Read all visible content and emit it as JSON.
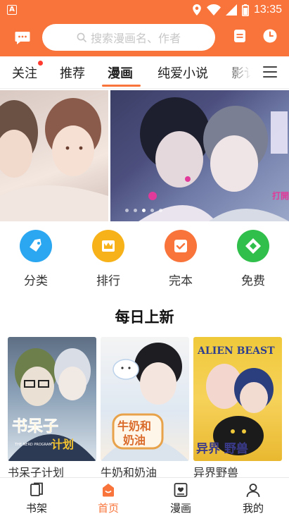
{
  "status_bar": {
    "time": "13:35",
    "icons": [
      "app-notification-icon",
      "location-icon",
      "wifi-icon",
      "signal-icon",
      "battery-icon"
    ]
  },
  "header": {
    "search_placeholder": "搜索漫画名、作者",
    "icons": [
      "chat-icon",
      "history-icon",
      "clock-icon"
    ]
  },
  "tabs": {
    "items": [
      {
        "label": "关注",
        "badge": true
      },
      {
        "label": "推荐"
      },
      {
        "label": "漫画",
        "active": true
      },
      {
        "label": "纯爱小说"
      },
      {
        "label": "影讠"
      }
    ],
    "menu_icon": "menu-icon"
  },
  "banner": {
    "slide_count": 5,
    "active_index": 2,
    "overlay_text": "打開"
  },
  "categories": [
    {
      "label": "分类",
      "icon": "tag-icon",
      "color": "#2aa7f0"
    },
    {
      "label": "排行",
      "icon": "crown-icon",
      "color": "#f7b21a"
    },
    {
      "label": "完本",
      "icon": "check-box-icon",
      "color": "#f8743a"
    },
    {
      "label": "免费",
      "icon": "diamond-icon",
      "color": "#2fbf4a"
    }
  ],
  "section": {
    "title": "每日上新"
  },
  "books": [
    {
      "title": "书呆子计划",
      "cover_text": "书呆子",
      "cover_subtext": "计划",
      "cover_caption": "THE NERD PROGRAM"
    },
    {
      "title": "牛奶和奶油",
      "cover_text": "牛奶和",
      "cover_subtext": "奶油"
    },
    {
      "title": "异界野兽",
      "cover_text": "ALIEN BEAST",
      "cover_subtext": "异界 野兽"
    }
  ],
  "bottom_nav": [
    {
      "label": "书架",
      "icon": "bookshelf-icon"
    },
    {
      "label": "首页",
      "icon": "home-icon",
      "active": true
    },
    {
      "label": "漫画",
      "icon": "comic-icon"
    },
    {
      "label": "我的",
      "icon": "profile-icon"
    }
  ],
  "colors": {
    "brand": "#f8743a",
    "badge": "#ff3b30"
  }
}
